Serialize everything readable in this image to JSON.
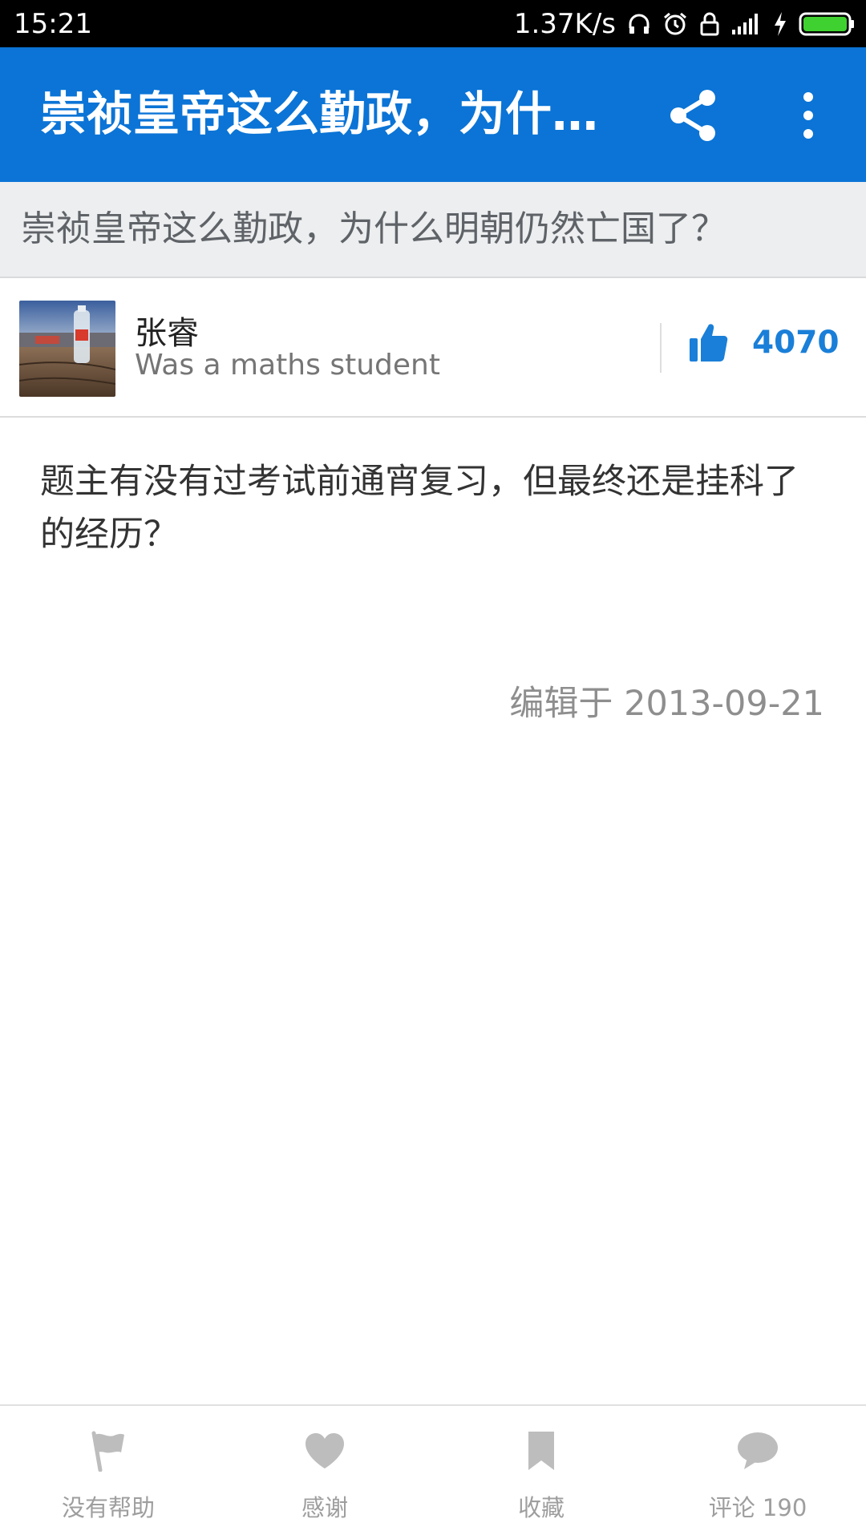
{
  "status_bar": {
    "time": "15:21",
    "net_speed": "1.37K/s",
    "icons": [
      "headphones-icon",
      "alarm-icon",
      "lock-icon",
      "signal-icon",
      "charging-icon",
      "battery-icon"
    ]
  },
  "app_bar": {
    "title": "崇祯皇帝这么勤政，为什…",
    "share_icon": "share-icon",
    "more_icon": "more-vert-icon"
  },
  "question": {
    "title": "崇祯皇帝这么勤政，为什么明朝仍然亡国了？"
  },
  "author": {
    "name": "张睿",
    "bio": "Was a maths student",
    "upvotes": "4070"
  },
  "answer": {
    "text": "题主有没有过考试前通宵复习，但最终还是挂科了的经历？",
    "edited": "编辑于 2013-09-21"
  },
  "bottom_bar": {
    "items": [
      {
        "label": "没有帮助",
        "icon": "flag-icon"
      },
      {
        "label": "感谢",
        "icon": "heart-icon"
      },
      {
        "label": "收藏",
        "icon": "bookmark-icon"
      },
      {
        "label": "评论 190",
        "icon": "comment-icon"
      }
    ]
  },
  "colors": {
    "primary": "#0b74d6",
    "upvote": "#1a7fd8",
    "tab_icon": "#bdbdbd"
  }
}
